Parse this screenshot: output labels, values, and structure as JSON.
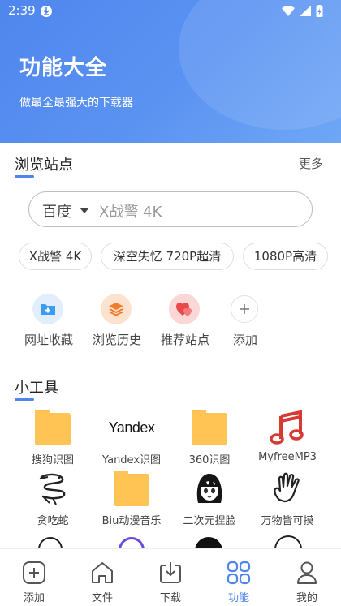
{
  "status_bar": {
    "time": "2:39"
  },
  "header": {
    "title": "功能大全",
    "subtitle": "做最全最强大的下载器"
  },
  "browse_section": {
    "title": "浏览站点",
    "more": "更多",
    "search": {
      "engine": "百度",
      "placeholder": "X战警 4K"
    },
    "chips": [
      "X战警 4K",
      "深空失忆 720P超清",
      "1080P高清"
    ],
    "quick_actions": [
      {
        "label": "网址收藏",
        "icon": "folder-plus-icon"
      },
      {
        "label": "浏览历史",
        "icon": "layers-icon"
      },
      {
        "label": "推荐站点",
        "icon": "hearts-icon"
      },
      {
        "label": "添加",
        "icon": "plus-icon"
      }
    ]
  },
  "tools_section": {
    "title": "小工具",
    "tools": [
      {
        "label": "搜狗识图",
        "icon": "folder-icon"
      },
      {
        "label": "Yandex识图",
        "icon": "yandex-logo",
        "logo_text": "Yandex"
      },
      {
        "label": "360识图",
        "icon": "folder-icon"
      },
      {
        "label": "MyfreeMP3",
        "icon": "music-note-icon"
      },
      {
        "label": "贪吃蛇",
        "icon": "snake-icon"
      },
      {
        "label": "Biu动漫音乐",
        "icon": "folder-icon"
      },
      {
        "label": "二次元捏脸",
        "icon": "anime-face-icon"
      },
      {
        "label": "万物皆可摸",
        "icon": "hand-icon"
      }
    ]
  },
  "bottom_nav": {
    "items": [
      {
        "label": "添加",
        "icon": "add-icon"
      },
      {
        "label": "文件",
        "icon": "home-icon"
      },
      {
        "label": "下载",
        "icon": "download-icon"
      },
      {
        "label": "功能",
        "icon": "grid-icon",
        "active": true
      },
      {
        "label": "我的",
        "icon": "person-icon"
      }
    ]
  },
  "colors": {
    "accent": "#4f86ee",
    "header_start": "#4f86ee",
    "header_end": "#6fa7f6",
    "folder": "#ffc454",
    "music_red": "#d63a33"
  }
}
